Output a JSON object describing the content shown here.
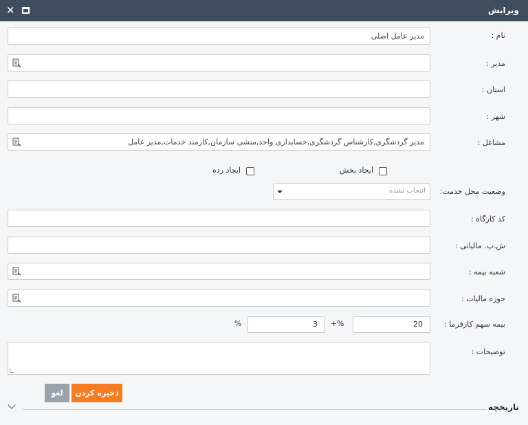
{
  "window": {
    "title": "ویرایش",
    "close_icon": "✕"
  },
  "fields": {
    "name": {
      "label": "نام :",
      "value": "مدیر عامل اصلی"
    },
    "manager": {
      "label": "مدیر :",
      "value": ""
    },
    "province": {
      "label": "استان :",
      "value": ""
    },
    "city": {
      "label": "شهر :",
      "value": ""
    },
    "jobs": {
      "label": "مشاغل :",
      "value": "مدیر گردشگری,کارشناس گردشگری,حسابداری واحد,منشی سازمان,کارمند خدمات,مدیر عامل"
    },
    "create_section": {
      "label": "ایجاد بخش",
      "checked": false
    },
    "create_rank": {
      "label": "ایجاد رده",
      "checked": false
    },
    "service_status": {
      "label": "وضعیت محل خدمت:",
      "placeholder": "انتخاب نشده"
    },
    "workshop_code": {
      "label": "کد کارگاه :",
      "value": ""
    },
    "tax_id": {
      "label": "ش.پ. مالیاتی :",
      "value": ""
    },
    "insurance_branch": {
      "label": "شعبه بیمه :",
      "value": ""
    },
    "tax_area": {
      "label": "حوزه مالیات :",
      "value": ""
    },
    "employer_share": {
      "label": "بیمه سهم کارفرما :",
      "value1": "20",
      "pct1": "%",
      "plus": "+",
      "value2": "3",
      "pct2": "%"
    },
    "description": {
      "label": "توضیحات :",
      "value": ""
    }
  },
  "buttons": {
    "save": "ذخیره کردن",
    "cancel": "لغو"
  },
  "history": {
    "label": "تاریخچه"
  }
}
